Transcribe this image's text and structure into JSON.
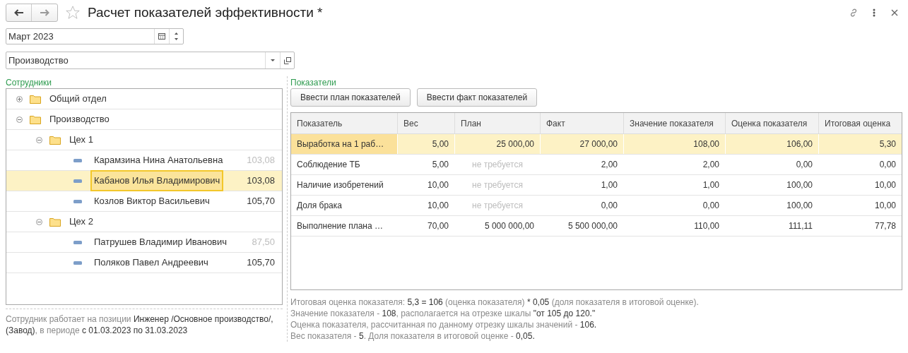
{
  "window": {
    "title": "Расчет показателей эффективности *",
    "favorite": false
  },
  "period": {
    "value": "Март 2023"
  },
  "department": {
    "value": "Производство"
  },
  "employees": {
    "label": "Сотрудники",
    "tree": [
      {
        "kind": "group",
        "name": "Общий отдел",
        "expanded": false,
        "selected": false
      },
      {
        "kind": "group",
        "name": "Производство",
        "expanded": true,
        "selected": false,
        "children": [
          {
            "kind": "group",
            "name": "Цех 1",
            "expanded": true,
            "selected": false,
            "children": [
              {
                "kind": "person",
                "name": "Карамзина Нина Анатольевна",
                "score": "103,08",
                "dimmed": true,
                "selected": false
              },
              {
                "kind": "person",
                "name": "Кабанов Илья Владимирович",
                "score": "103,08",
                "dimmed": false,
                "selected": true
              },
              {
                "kind": "person",
                "name": "Козлов Виктор Васильевич",
                "score": "105,70",
                "dimmed": false,
                "selected": false
              }
            ]
          },
          {
            "kind": "group",
            "name": "Цех 2",
            "expanded": true,
            "selected": false,
            "children": [
              {
                "kind": "person",
                "name": "Патрушев Владимир Иванович",
                "score": "87,50",
                "dimmed": true,
                "selected": false
              },
              {
                "kind": "person",
                "name": "Поляков Павел Андреевич",
                "score": "105,70",
                "dimmed": false,
                "selected": false
              }
            ]
          }
        ]
      }
    ],
    "note": [
      {
        "text": "Сотрудник работает на позиции ",
        "strong": false
      },
      {
        "text": "Инженер /Основное производство/, (Завод)",
        "strong": true
      },
      {
        "text": ", в периоде ",
        "strong": false
      },
      {
        "text": "с 01.03.2023 по 31.03.2023",
        "strong": true
      }
    ]
  },
  "indicators": {
    "label": "Показатели",
    "buttons": [
      "Ввести план показателей",
      "Ввести факт показателей"
    ],
    "columns": [
      "Показатель",
      "Вес",
      "План",
      "Факт",
      "Значение показателя",
      "Оценка показателя",
      "Итоговая оценка"
    ],
    "rows": [
      {
        "cells": [
          "Выработка на 1 раб…",
          "5,00",
          "25 000,00",
          "27 000,00",
          "108,00",
          "106,00",
          "5,30"
        ],
        "plan_required": true,
        "selected": true
      },
      {
        "cells": [
          "Соблюдение ТБ",
          "5,00",
          "не требуется",
          "2,00",
          "2,00",
          "0,00",
          "0,00"
        ],
        "plan_required": false,
        "selected": false
      },
      {
        "cells": [
          "Наличие изобретений",
          "10,00",
          "не требуется",
          "1,00",
          "1,00",
          "100,00",
          "10,00"
        ],
        "plan_required": false,
        "selected": false
      },
      {
        "cells": [
          "Доля брака",
          "10,00",
          "не требуется",
          "0,00",
          "0,00",
          "100,00",
          "10,00"
        ],
        "plan_required": false,
        "selected": false
      },
      {
        "cells": [
          "Выполнение плана …",
          "70,00",
          "5 000 000,00",
          "5 500 000,00",
          "110,00",
          "111,11",
          "77,78"
        ],
        "plan_required": true,
        "selected": false
      }
    ],
    "explanation": [
      [
        {
          "text": "Итоговая оценка показателя: ",
          "strong": false
        },
        {
          "text": "5,3 = 106",
          "strong": true
        },
        {
          "text": " (оценка показателя) ",
          "strong": false
        },
        {
          "text": "* 0,05",
          "strong": true
        },
        {
          "text": " (доля показателя в итоговой оценке).",
          "strong": false
        }
      ],
      [
        {
          "text": "Значение показателя - ",
          "strong": false
        },
        {
          "text": "108",
          "strong": true
        },
        {
          "text": ", располагается на отрезке шкалы ",
          "strong": false
        },
        {
          "text": "\"от 105 до 120.\"",
          "strong": true
        }
      ],
      [
        {
          "text": "Оценка показателя, рассчитанная по данному отрезку шкалы значений - ",
          "strong": false
        },
        {
          "text": "106.",
          "strong": true
        }
      ],
      [
        {
          "text": "Вес показателя - ",
          "strong": false
        },
        {
          "text": "5",
          "strong": true
        },
        {
          "text": ". Доля показателя в итоговой оценке - ",
          "strong": false
        },
        {
          "text": "0,05.",
          "strong": true
        }
      ]
    ]
  }
}
